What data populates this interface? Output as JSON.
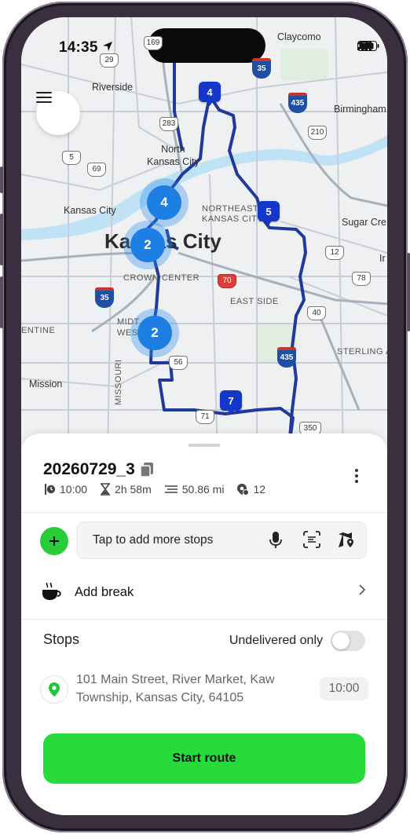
{
  "status_bar": {
    "time": "14:35"
  },
  "map": {
    "labels": {
      "riverside": "Riverside",
      "claycomo": "Claycomo",
      "birmingham": "Birmingham",
      "north_kansas_city": "North\nKansas City",
      "kansas_city_small": "Kansas City",
      "northeast": "NORTHEAST",
      "kansas_city_caps": "KANSAS CITY",
      "sugar_creek": "Sugar Cre",
      "kansas_city_big": "Kansas City",
      "crown_center": "CROWN CENTER",
      "east_side": "EAST SIDE",
      "entine": "ENTINE",
      "midtown_west": "MIDT\nWES",
      "sterling": "STERLING A",
      "missouri": "MISSOURI",
      "mission": "Mission",
      "ir": "Ir"
    },
    "shields": [
      "29",
      "283",
      "210",
      "169",
      "5",
      "69",
      "12",
      "78",
      "70",
      "40",
      "35",
      "56",
      "71",
      "350",
      "435",
      "35",
      "435"
    ],
    "clusters": [
      {
        "count": "4"
      },
      {
        "count": "2"
      },
      {
        "count": "2"
      }
    ],
    "pins": [
      {
        "num": "4"
      },
      {
        "num": "5"
      },
      {
        "num": "7"
      }
    ]
  },
  "route": {
    "name": "20260729_3",
    "start_time": "10:00",
    "duration": "2h 58m",
    "distance": "50.86 mi",
    "stops_count": "12"
  },
  "add_stops": {
    "placeholder": "Tap to add more stops"
  },
  "add_break": {
    "label": "Add break"
  },
  "stops_section": {
    "title": "Stops",
    "filter_label": "Undelivered only"
  },
  "stops": [
    {
      "address": "101 Main Street, River Market, Kaw Township, Kansas City, 64105",
      "time": "10:00"
    }
  ],
  "cta": {
    "label": "Start route"
  },
  "colors": {
    "accent_green": "#27da3c",
    "route_blue": "#1f3a9c",
    "pin_blue": "#1436c9",
    "cluster_blue": "#1d7fe3"
  },
  "icons": [
    "menu-icon",
    "copy-icon",
    "clock-icon",
    "hourglass-icon",
    "distance-icon",
    "stops-icon",
    "more-vertical-icon",
    "plus-icon",
    "microphone-icon",
    "scan-icon",
    "map-pin-icon",
    "coffee-icon",
    "chevron-right-icon",
    "location-pin-icon"
  ]
}
